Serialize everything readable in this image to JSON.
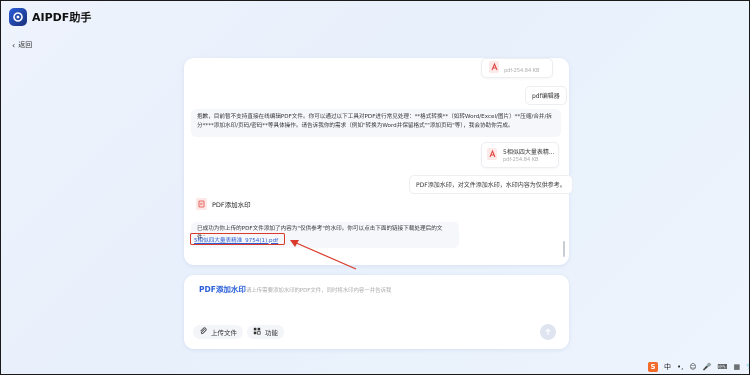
{
  "app": {
    "title": "AIPDF助手"
  },
  "nav": {
    "back_label": "返回"
  },
  "chat": {
    "top_file": {
      "name": "",
      "size": "pdf-254.84 KB"
    },
    "user_msg_1": "pdf编辑器",
    "ai_msg_1": "抱歉，目前暂不支持直接在线编辑PDF文件。你可以通过以下工具对PDF进行常见处理：**格式转换**（如转Word/Excel/图片）**压缩/合并/拆分****添加水印/页码/密码**等具体操作。请告诉我你的需求（例如\"转换为Word并保留格式\"\"添加页码\"等），我会协助你完成。",
    "user_file": {
      "name": "5相似四大量表精...",
      "size": "pdf-254.84 KB"
    },
    "user_msg_2": "PDF添加水印，对文件添加水印，水印内容为仅供参考。",
    "tool_label": "PDF添加水印",
    "ai_msg_2": "已成功为你上传的PDF文件添加了内容为\"仅供参考\"的水印。你可以点击下面的链接下载处理后的文件：",
    "result_link": "5相似四大量表精准_9754(1).pdf"
  },
  "composer": {
    "tool_tag": "PDF添加水印",
    "hint": "请上传需要添加水印的PDF文件，同时将水印内容一并告诉我",
    "upload_label": "上传文件",
    "features_label": "功能"
  },
  "tray": {
    "lang": "中",
    "punct": "•,",
    "emoji": "☺",
    "mic": "🎤",
    "keyboard": "⌨",
    "grid": "▦",
    "shirt": "👕",
    "apps": "⁘"
  },
  "colors": {
    "accent": "#2b5fd9",
    "highlight": "#d93a2b"
  }
}
